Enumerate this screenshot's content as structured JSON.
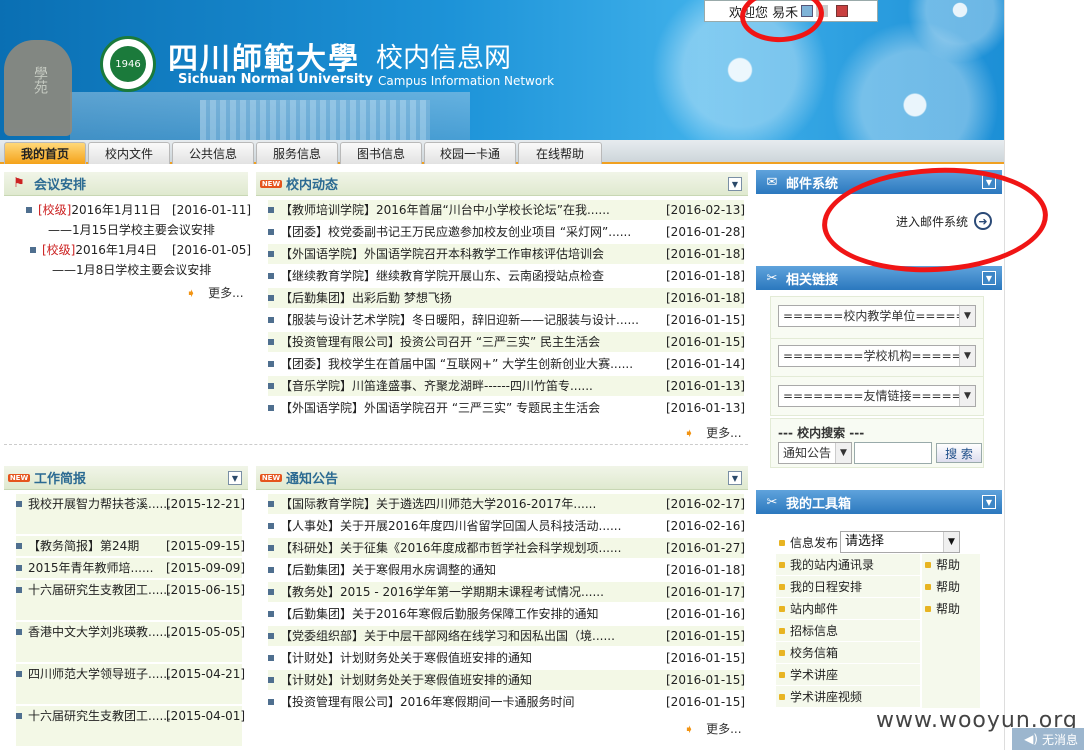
{
  "banner": {
    "university_cn": "四川師範大學",
    "university_en": "Sichuan Normal University",
    "site_cn": "校内信息网",
    "site_en": "Campus Information Network",
    "stone_text": "學苑",
    "logo_text": "1946",
    "welcome": "欢迎您 易禾"
  },
  "nav": {
    "tabs": [
      "我的首页",
      "校内文件",
      "公共信息",
      "服务信息",
      "图书信息",
      "校园一卡通",
      "在线帮助"
    ]
  },
  "meetings": {
    "title": "会议安排",
    "items": [
      {
        "tag": "[校级]",
        "text": "2016年1月11日",
        "date": "[2016-01-11]",
        "sub": "——1月15日学校主要会议安排"
      },
      {
        "tag": "[校级]",
        "text": "2016年1月4日",
        "date": "[2016-01-05]",
        "sub": "——1月8日学校主要会议安排"
      }
    ],
    "more": "更多..."
  },
  "news": {
    "title": "校内动态",
    "badge": "NEW",
    "items": [
      {
        "text": "【教师培训学院】2016年首届“川台中小学校长论坛”在我......",
        "date": "[2016-02-13]"
      },
      {
        "text": "【团委】校党委副书记王万民应邀参加校友创业项目 “采灯网”......",
        "date": "[2016-01-28]"
      },
      {
        "text": "【外国语学院】外国语学院召开本科教学工作审核评估培训会",
        "date": "[2016-01-18]"
      },
      {
        "text": "【继续教育学院】继续教育学院开展山东、云南函授站点检查",
        "date": "[2016-01-18]"
      },
      {
        "text": "【后勤集团】出彩后勤 梦想飞扬",
        "date": "[2016-01-18]"
      },
      {
        "text": "【服装与设计艺术学院】冬日暖阳，辞旧迎新——记服装与设计......",
        "date": "[2016-01-15]"
      },
      {
        "text": "【投资管理有限公司】投资公司召开 “三严三实” 民主生活会",
        "date": "[2016-01-15]"
      },
      {
        "text": "【团委】我校学生在首届中国 “互联网+” 大学生创新创业大赛......",
        "date": "[2016-01-14]"
      },
      {
        "text": "【音乐学院】川笛逢盛事、齐聚龙湖畔------四川竹笛专......",
        "date": "[2016-01-13]"
      },
      {
        "text": "【外国语学院】外国语学院召开 “三严三实” 专题民主生活会",
        "date": "[2016-01-13]"
      }
    ],
    "more": "更多..."
  },
  "briefs": {
    "title": "工作简报",
    "badge": "NEW",
    "items": [
      {
        "text": "我校开展智力帮扶苍溪......",
        "date": "[2015-12-21]"
      },
      {
        "text": "【教务简报】第24期",
        "date": "[2015-09-15]"
      },
      {
        "text": "2015年青年教师培......",
        "date": "[2015-09-09]"
      },
      {
        "text": "十六届研究生支教团工......",
        "date": "[2015-06-15]"
      },
      {
        "text": "香港中文大学刘兆瑛教......",
        "date": "[2015-05-05]"
      },
      {
        "text": "四川师范大学领导班子......",
        "date": "[2015-04-21]"
      },
      {
        "text": "十六届研究生支教团工......",
        "date": "[2015-04-01]"
      }
    ]
  },
  "notices": {
    "title": "通知公告",
    "badge": "NEW",
    "items": [
      {
        "text": "【国际教育学院】关于遴选四川师范大学2016-2017年......",
        "date": "[2016-02-17]"
      },
      {
        "text": "【人事处】关于开展2016年度四川省留学回国人员科技活动......",
        "date": "[2016-02-16]"
      },
      {
        "text": "【科研处】关于征集《2016年度成都市哲学社会科学规划项......",
        "date": "[2016-01-27]"
      },
      {
        "text": "【后勤集团】关于寒假用水房调整的通知",
        "date": "[2016-01-18]"
      },
      {
        "text": "【教务处】2015 - 2016学年第一学期期末课程考试情况......",
        "date": "[2016-01-17]"
      },
      {
        "text": "【后勤集团】关于2016年寒假后勤服务保障工作安排的通知",
        "date": "[2016-01-16]"
      },
      {
        "text": "【党委组织部】关于中层干部网络在线学习和因私出国（境......",
        "date": "[2016-01-15]"
      },
      {
        "text": "【计财处】计划财务处关于寒假值班安排的通知",
        "date": "[2016-01-15]"
      },
      {
        "text": "【计财处】计划财务处关于寒假值班安排的通知",
        "date": "[2016-01-15]"
      },
      {
        "text": "【投资管理有限公司】2016年寒假期间一卡通服务时间",
        "date": "[2016-01-15]"
      }
    ],
    "more": "更多..."
  },
  "mail": {
    "title": "邮件系统",
    "enter": "进入邮件系统"
  },
  "links": {
    "title": "相关链接",
    "selects": [
      "======校内教学单位======",
      "========学校机构========",
      "========友情链接========"
    ]
  },
  "search": {
    "title": "--- 校内搜索 ---",
    "scope": "通知公告",
    "button": "搜 索"
  },
  "tools": {
    "title": "我的工具箱",
    "publish_label": "信息发布",
    "publish_select": "请选择",
    "items": [
      "我的站内通讯录",
      "我的日程安排",
      "站内邮件",
      "招标信息",
      "校务信箱",
      "学术讲座",
      "学术讲座视频"
    ],
    "help": [
      "帮助",
      "帮助",
      "帮助"
    ]
  },
  "watermark": "www.wooyun.org",
  "status": {
    "nomsg": "无消息"
  }
}
